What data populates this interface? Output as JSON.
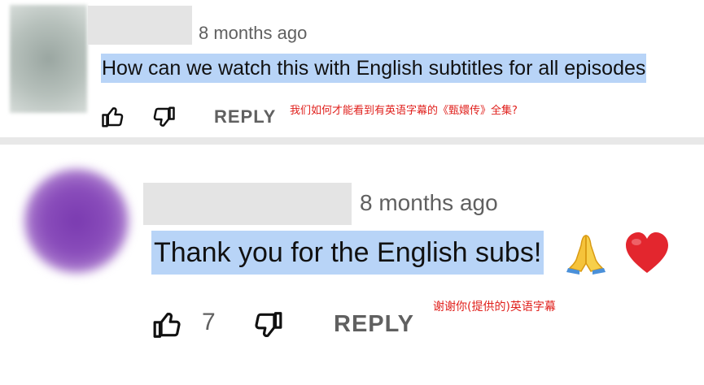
{
  "comments": [
    {
      "timestamp": "8 months ago",
      "text": "How can we watch this with English subtitles for all episodes",
      "reply_label": "REPLY",
      "translation": "我们如何才能看到有英语字幕的《甄嬛传》全集?"
    },
    {
      "timestamp": "8 months ago",
      "text": "Thank you for the English subs!",
      "emojis": [
        "folded-hands",
        "red-heart"
      ],
      "like_count": "7",
      "reply_label": "REPLY",
      "translation": "谢谢你(提供的)英语字幕"
    }
  ],
  "colors": {
    "highlight": "#b8d4f7",
    "annotation": "#e0201c",
    "muted_text": "#606060",
    "avatar_purple": "#7a3ab0"
  }
}
